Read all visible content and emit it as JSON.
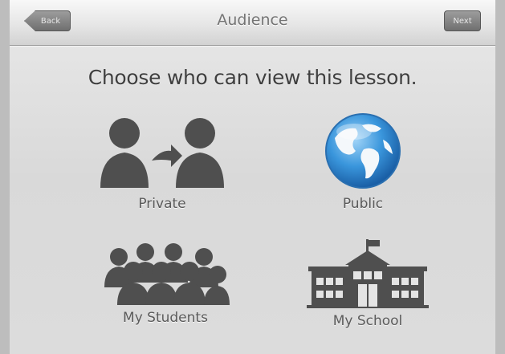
{
  "navbar": {
    "title": "Audience",
    "back_label": "Back",
    "next_label": "Next"
  },
  "heading": "Choose who can view this lesson.",
  "options": [
    {
      "label": "Private",
      "icon": "person-to-person-icon"
    },
    {
      "label": "Public",
      "icon": "globe-icon"
    },
    {
      "label": "My Students",
      "icon": "group-of-people-icon"
    },
    {
      "label": "My School",
      "icon": "school-building-icon"
    }
  ],
  "colors": {
    "icon_gray": "#4d4d4d",
    "globe_blue": "#2f8fd6",
    "background": "#dcdcdc"
  }
}
